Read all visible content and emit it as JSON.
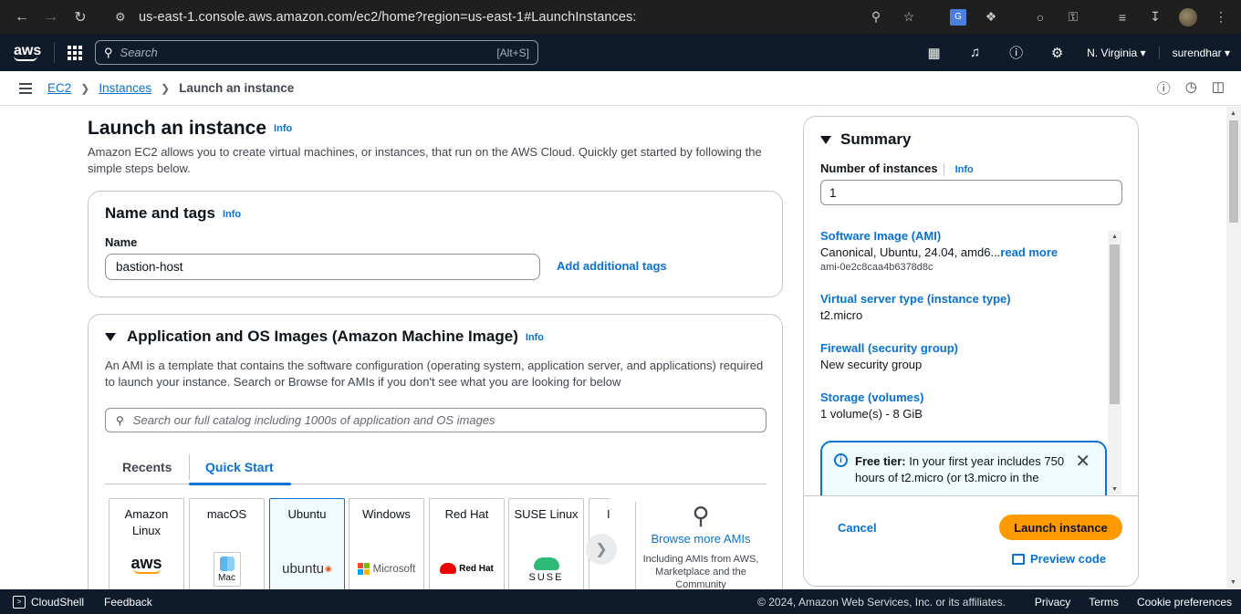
{
  "browser": {
    "url": "us-east-1.console.aws.amazon.com/ec2/home?region=us-east-1#LaunchInstances:"
  },
  "topnav": {
    "logo": "aws",
    "search_placeholder": "Search",
    "search_shortcut": "[Alt+S]",
    "region": "N. Virginia",
    "user": "surendhar"
  },
  "breadcrumb": {
    "items": [
      "EC2",
      "Instances"
    ],
    "current": "Launch an instance"
  },
  "page": {
    "title": "Launch an instance",
    "info": "Info",
    "description": "Amazon EC2 allows you to create virtual machines, or instances, that run on the AWS Cloud. Quickly get started by following the simple steps below."
  },
  "name_tags": {
    "title": "Name and tags",
    "info": "Info",
    "name_label": "Name",
    "name_value": "bastion-host",
    "add_tags": "Add additional tags"
  },
  "ami_section": {
    "title": "Application and OS Images (Amazon Machine Image)",
    "info": "Info",
    "description": "An AMI is a template that contains the software configuration (operating system, application server, and applications) required to launch your instance. Search or Browse for AMIs if you don't see what you are looking for below",
    "search_placeholder": "Search our full catalog including 1000s of application and OS images",
    "tabs": [
      "Recents",
      "Quick Start"
    ],
    "tiles": [
      {
        "name": "Amazon Linux",
        "logo": "aws"
      },
      {
        "name": "macOS",
        "logo": "Mac"
      },
      {
        "name": "Ubuntu",
        "logo": "ubuntu"
      },
      {
        "name": "Windows",
        "logo": "Microsoft"
      },
      {
        "name": "Red Hat",
        "logo": "Red Hat"
      },
      {
        "name": "SUSE Linux",
        "logo": "SUSE"
      },
      {
        "name": "I",
        "logo": ""
      }
    ],
    "browse_title": "Browse more AMIs",
    "browse_sub": "Including AMIs from AWS, Marketplace and the Community"
  },
  "summary": {
    "title": "Summary",
    "num_label": "Number of instances",
    "info": "Info",
    "num_value": "1",
    "ami_label": "Software Image (AMI)",
    "ami_value": "Canonical, Ubuntu, 24.04, amd6...",
    "ami_readmore": "read more",
    "ami_id": "ami-0e2c8caa4b6378d8c",
    "type_label": "Virtual server type (instance type)",
    "type_value": "t2.micro",
    "fw_label": "Firewall (security group)",
    "fw_value": "New security group",
    "storage_label": "Storage (volumes)",
    "storage_value": "1 volume(s) - 8 GiB",
    "free_tier_bold": "Free tier:",
    "free_tier_text": " In your first year includes 750 hours of t2.micro (or t3.micro in the",
    "cancel": "Cancel",
    "launch": "Launch instance",
    "preview": "Preview code"
  },
  "footer": {
    "cloudshell": "CloudShell",
    "feedback": "Feedback",
    "copyright": "© 2024, Amazon Web Services, Inc. or its affiliates.",
    "privacy": "Privacy",
    "terms": "Terms",
    "cookies": "Cookie preferences"
  }
}
